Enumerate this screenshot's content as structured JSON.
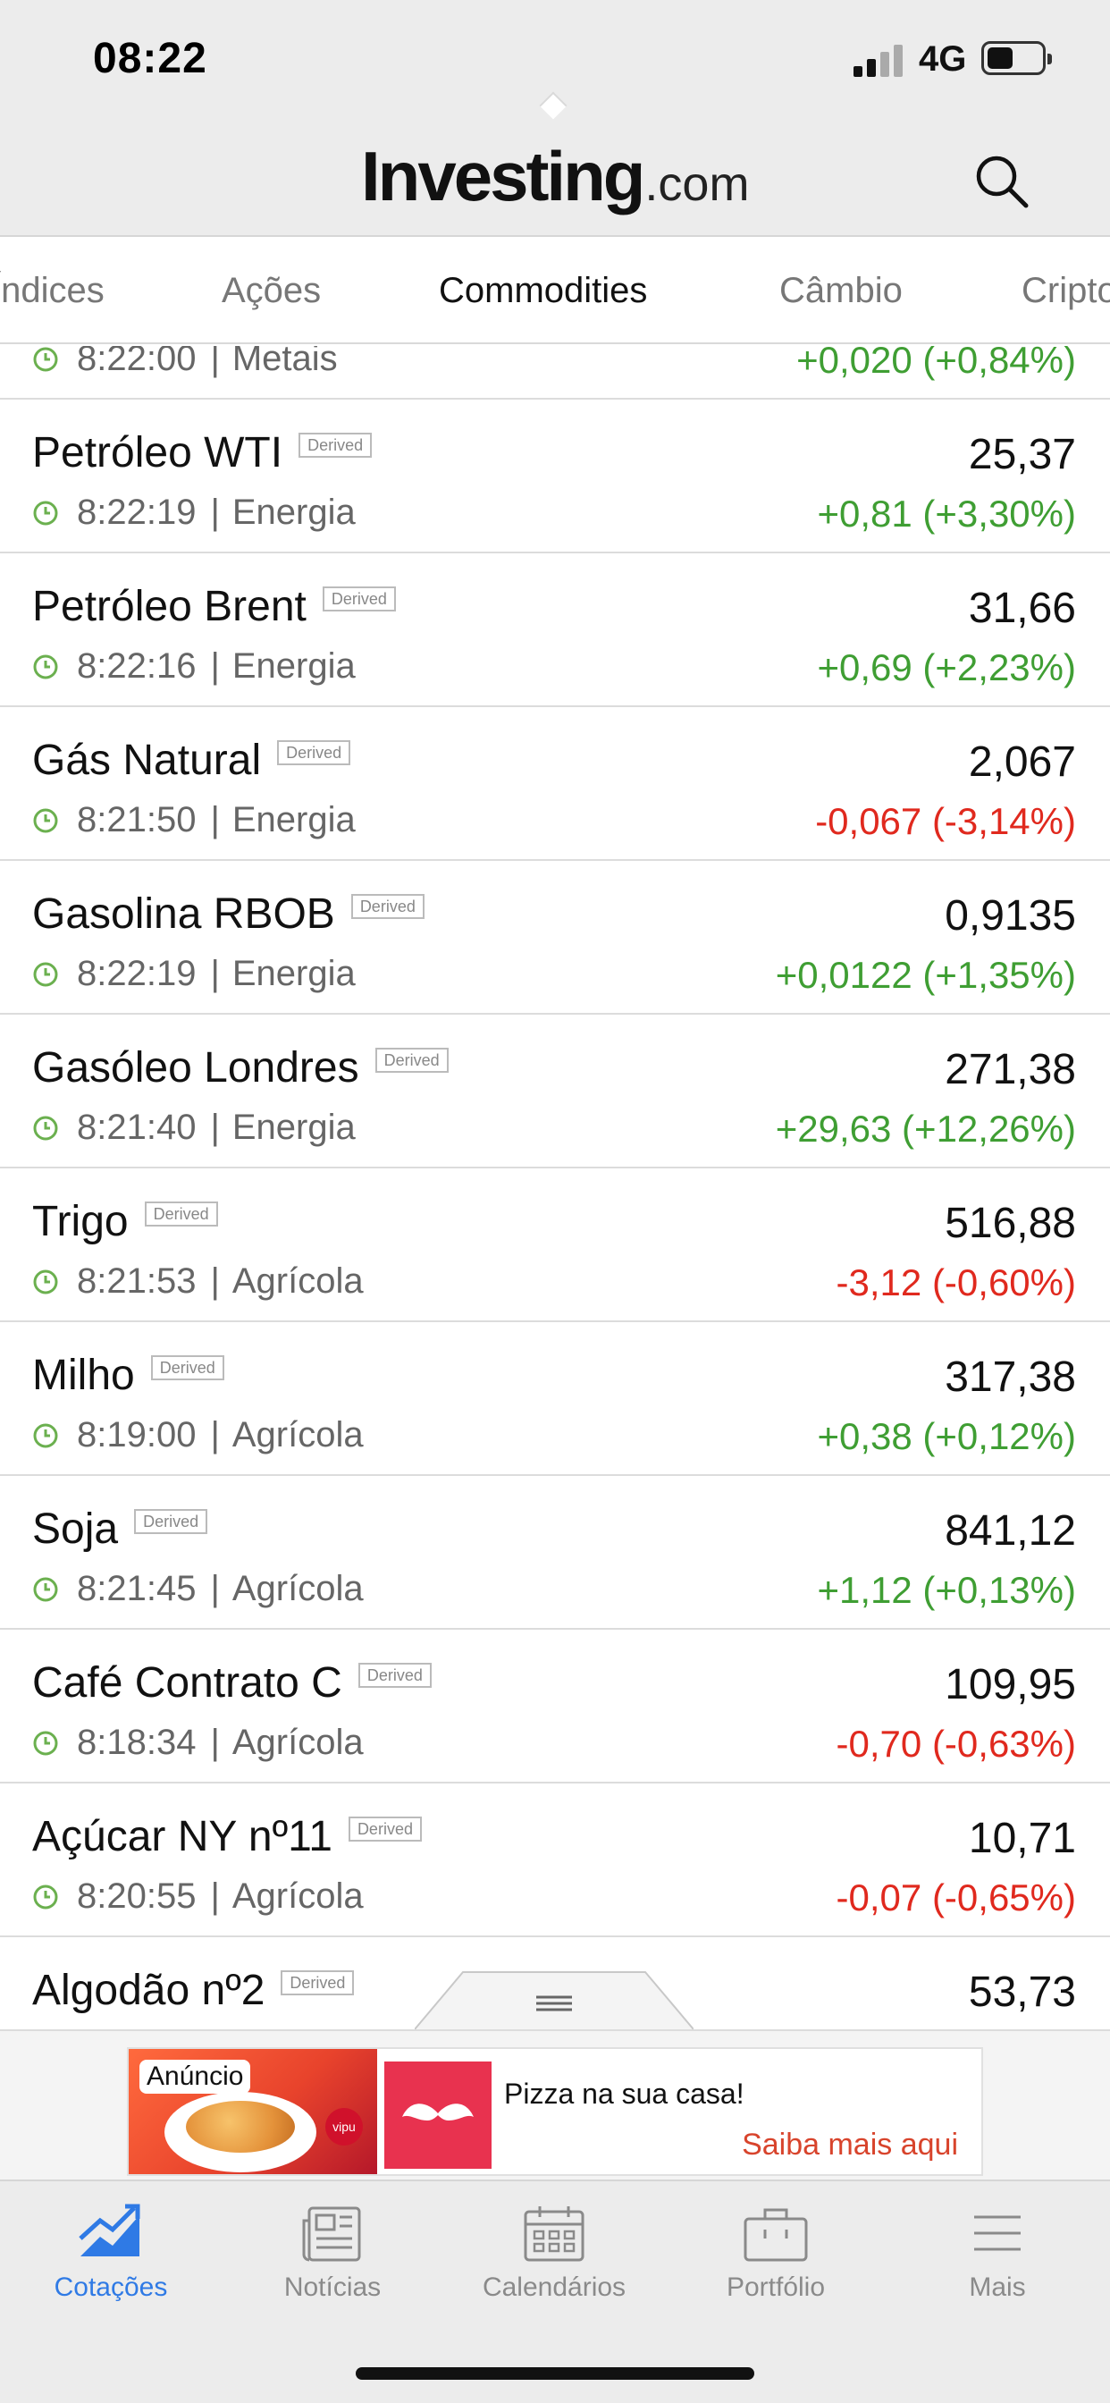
{
  "status_bar": {
    "time": "08:22",
    "network": "4G"
  },
  "header": {
    "logo_main": "Investing",
    "logo_suffix": ".com"
  },
  "tabs": [
    {
      "label": "Índices"
    },
    {
      "label": "Ações"
    },
    {
      "label": "Commodities",
      "active": true
    },
    {
      "label": "Câmbio"
    },
    {
      "label": "Cripto"
    }
  ],
  "partial_row": {
    "time": "8:22:00",
    "category": "Metais",
    "change": "+0,020 (+0,84%)",
    "direction": "up"
  },
  "rows": [
    {
      "name": "Petróleo WTI",
      "badge": "Derived",
      "time": "8:22:19",
      "category": "Energia",
      "price": "25,37",
      "change": "+0,81 (+3,30%)",
      "direction": "up"
    },
    {
      "name": "Petróleo Brent",
      "badge": "Derived",
      "time": "8:22:16",
      "category": "Energia",
      "price": "31,66",
      "change": "+0,69 (+2,23%)",
      "direction": "up"
    },
    {
      "name": "Gás Natural",
      "badge": "Derived",
      "time": "8:21:50",
      "category": "Energia",
      "price": "2,067",
      "change": "-0,067 (-3,14%)",
      "direction": "down"
    },
    {
      "name": "Gasolina RBOB",
      "badge": "Derived",
      "time": "8:22:19",
      "category": "Energia",
      "price": "0,9135",
      "change": "+0,0122 (+1,35%)",
      "direction": "up"
    },
    {
      "name": "Gasóleo Londres",
      "badge": "Derived",
      "time": "8:21:40",
      "category": "Energia",
      "price": "271,38",
      "change": "+29,63 (+12,26%)",
      "direction": "up"
    },
    {
      "name": "Trigo",
      "badge": "Derived",
      "time": "8:21:53",
      "category": "Agrícola",
      "price": "516,88",
      "change": "-3,12 (-0,60%)",
      "direction": "down"
    },
    {
      "name": "Milho",
      "badge": "Derived",
      "time": "8:19:00",
      "category": "Agrícola",
      "price": "317,38",
      "change": "+0,38 (+0,12%)",
      "direction": "up"
    },
    {
      "name": "Soja",
      "badge": "Derived",
      "time": "8:21:45",
      "category": "Agrícola",
      "price": "841,12",
      "change": "+1,12 (+0,13%)",
      "direction": "up"
    },
    {
      "name": "Café Contrato C",
      "badge": "Derived",
      "time": "8:18:34",
      "category": "Agrícola",
      "price": "109,95",
      "change": "-0,70 (-0,63%)",
      "direction": "down"
    },
    {
      "name": "Açúcar NY nº11",
      "badge": "Derived",
      "time": "8:20:55",
      "category": "Agrícola",
      "price": "10,71",
      "change": "-0,07 (-0,65%)",
      "direction": "down"
    },
    {
      "name": "Algodão nº2",
      "badge": "Derived",
      "time": "",
      "category": "",
      "price": "53,73",
      "change": "",
      "direction": "up"
    }
  ],
  "ad": {
    "label": "Anúncio",
    "title": "Pizza na sua casa!",
    "cta": "Saiba mais aqui",
    "brand_mark": "vipu"
  },
  "bottom_nav": [
    {
      "label": "Cotações",
      "icon": "chart-up-icon",
      "active": true
    },
    {
      "label": "Notícias",
      "icon": "newspaper-icon"
    },
    {
      "label": "Calendários",
      "icon": "calendar-icon"
    },
    {
      "label": "Portfólio",
      "icon": "briefcase-icon"
    },
    {
      "label": "Mais",
      "icon": "menu-icon"
    }
  ],
  "colors": {
    "up": "#3f9e33",
    "down": "#e0291e",
    "accent": "#2f7ae5",
    "logo_dot": "#f5a623"
  }
}
